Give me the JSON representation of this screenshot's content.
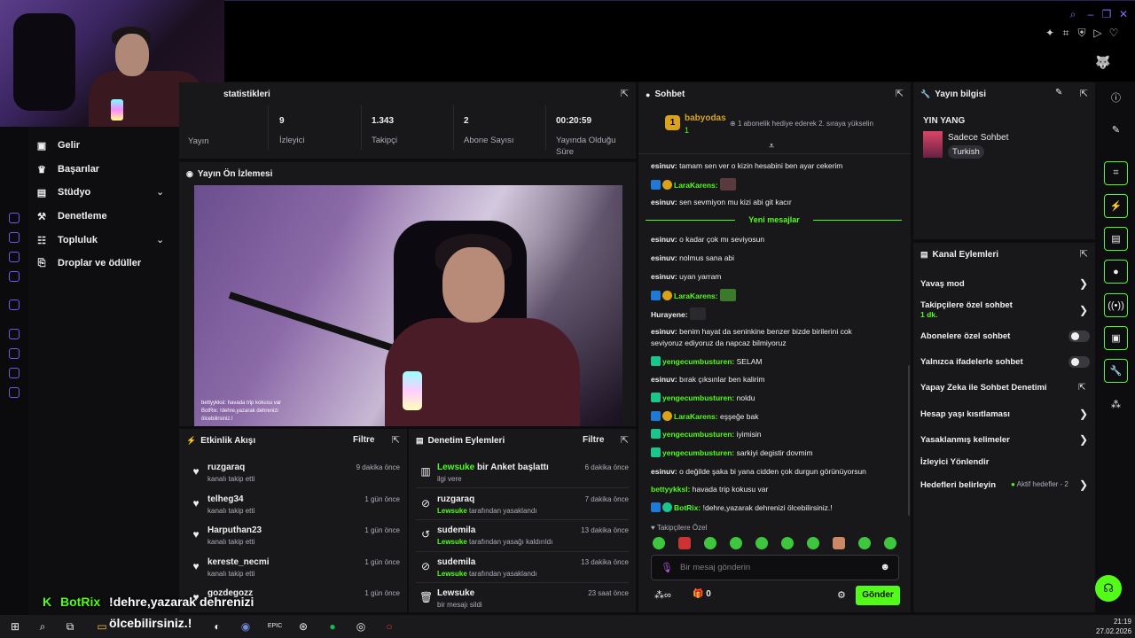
{
  "stats": {
    "title": "statistikleri",
    "items": [
      {
        "value": "",
        "label": "Yayın"
      },
      {
        "value": "9",
        "label": "İzleyici"
      },
      {
        "value": "1.343",
        "label": "Takipçi"
      },
      {
        "value": "2",
        "label": "Abone Sayısı"
      },
      {
        "value": "00:20:59",
        "label": "Yayında Olduğu Süre"
      }
    ]
  },
  "sidebar": {
    "items": [
      {
        "label": "Gelir",
        "icon": "coin-icon"
      },
      {
        "label": "Başarılar",
        "icon": "trophy-icon"
      },
      {
        "label": "Stüdyo",
        "icon": "studio-icon"
      },
      {
        "label": "Denetleme",
        "icon": "hammer-icon"
      },
      {
        "label": "Topluluk",
        "icon": "people-icon"
      },
      {
        "label": "Droplar ve ödüller",
        "icon": "gift-icon"
      }
    ]
  },
  "preview": {
    "title": "Yayın Ön İzlemesi",
    "overlay_line1": "bettyykksl: havada trip kokusu var",
    "overlay_line2": "BotRix: !dehre,yazarak dehrenizi",
    "overlay_line3": "ölcebilirsiniz.!"
  },
  "activity": {
    "title": "Etkinlik Akışı",
    "filter": "Filtre",
    "rows": [
      {
        "name": "ruzgaraq",
        "sub": "kanalı takip etti",
        "time": "9 dakika önce"
      },
      {
        "name": "telheg34",
        "sub": "kanalı takip etti",
        "time": "1 gün önce"
      },
      {
        "name": "Harputhan23",
        "sub": "kanalı takip etti",
        "time": "1 gün önce"
      },
      {
        "name": "kereste_necmi",
        "sub": "kanalı takip etti",
        "time": "1 gün önce"
      },
      {
        "name": "gozdegozz",
        "sub": "",
        "time": "1 gün önce"
      }
    ]
  },
  "moderation": {
    "title": "Denetim Eylemleri",
    "filter": "Filtre",
    "rows": [
      {
        "name": "Lewsuke",
        "action": "bir Anket başlattı",
        "sub": "ilgi vere",
        "by": "",
        "time": "6 dakika önce"
      },
      {
        "name": "ruzgaraq",
        "action": "",
        "sub": "tarafından yasaklandı",
        "by": "Lewsuke",
        "time": "7 dakika önce"
      },
      {
        "name": "sudemila",
        "action": "",
        "sub": "tarafından yasağı kaldırıldı",
        "by": "Lewsuke",
        "time": "13 dakika önce"
      },
      {
        "name": "sudemila",
        "action": "",
        "sub": "tarafından yasaklandı",
        "by": "Lewsuke",
        "time": "13 dakika önce"
      },
      {
        "name": "Lewsuke",
        "action": "",
        "sub": "bir mesajı sildi",
        "by": "",
        "time": "23 saat önce"
      }
    ]
  },
  "chat": {
    "title": "Sohbet",
    "pinned_user": "babyodas",
    "pinned_count": "1",
    "pinned_text": "1 abonelik hediye ederek 2. sıraya yükselin",
    "new_messages": "Yeni mesajlar",
    "messages": [
      {
        "user": "esinuv:",
        "text": "tamam sen ver o kizin hesabini ben ayar cekerim",
        "color": "#efeff1"
      },
      {
        "user": "LaraKarens:",
        "text": "",
        "color": "#53fc18"
      },
      {
        "user": "esinuv:",
        "text": "sen sevmiyon mu kizi abi git kacır",
        "color": "#efeff1"
      },
      {
        "user": "esinuv:",
        "text": "o kadar çok mı seviyosun",
        "color": "#efeff1"
      },
      {
        "user": "esinuv:",
        "text": "nolmus sana abi",
        "color": "#efeff1"
      },
      {
        "user": "esinuv:",
        "text": "uyan yarram",
        "color": "#efeff1"
      },
      {
        "user": "LaraKarens:",
        "text": "",
        "color": "#53fc18"
      },
      {
        "user": "Hurayene:",
        "text": "",
        "color": "#efeff1"
      },
      {
        "user": "esinuv:",
        "text": "benim hayat da seninkine benzer bizde birilerini cok",
        "color": "#efeff1"
      },
      {
        "user": "",
        "text": "seviyoruz ediyoruz da napcaz bilmiyoruz",
        "color": "#efeff1"
      },
      {
        "user": "yengecumbusturen:",
        "text": "SELAM",
        "color": "#53fc18"
      },
      {
        "user": "esinuv:",
        "text": "bırak çıksınlar ben kalirim",
        "color": "#efeff1"
      },
      {
        "user": "yengecumbusturen:",
        "text": "noldu",
        "color": "#53fc18"
      },
      {
        "user": "LaraKarens:",
        "text": "eşşeğe bak",
        "color": "#53fc18"
      },
      {
        "user": "yengecumbusturen:",
        "text": "iyimisin",
        "color": "#53fc18"
      },
      {
        "user": "yengecumbusturen:",
        "text": "sarkiyi degistir dovmim",
        "color": "#53fc18"
      },
      {
        "user": "esinuv:",
        "text": "o değilde şaka bi yana cidden çok durgun görünüyorsun",
        "color": "#efeff1"
      },
      {
        "user": "bettyykksl:",
        "text": "havada trip kokusu var",
        "color": "#53fc18"
      },
      {
        "user": "BotRix:",
        "text": "!dehre,yazarak dehrenizi ölcebilirsiniz.!",
        "color": "#53fc18"
      }
    ],
    "followers_only": "Takipçilere Özel",
    "input_placeholder": "Bir mesaj gönderin",
    "points": "∞",
    "gift_count": "0",
    "send": "Gönder"
  },
  "stream_info": {
    "title": "Yayın bilgisi",
    "stream_title": "YIN YANG",
    "category": "Sadece Sohbet",
    "tag": "Turkish"
  },
  "channel_actions": {
    "title": "Kanal Eylemleri",
    "slow": "Yavaş mod",
    "followers": "Takipçilere özel sohbet",
    "followers_sub": "1 dk.",
    "subs": "Abonelere özel sohbet",
    "emotes": "Yalnızca ifadelerle sohbet",
    "ai": "Yapay Zeka ile Sohbet Denetimi",
    "age": "Hesap yaşı kısıtlaması",
    "banned": "Yasaklanmış kelimeler",
    "redirect": "İzleyici Yönlendir",
    "goals": "Hedefleri belirleyin",
    "goals_sub": "Aktif hedefler - 2"
  },
  "bot_overlay": {
    "name": "BotRix",
    "text": "!dehre,yazarak dehrenizi",
    "text2": "ölcebilirsiniz.!"
  },
  "taskbar": {
    "time": "21:19",
    "date": "27.02.2026"
  },
  "colors": {
    "accent": "#53fc18",
    "purple": "#7b6ef6",
    "panel": "#18181b"
  }
}
